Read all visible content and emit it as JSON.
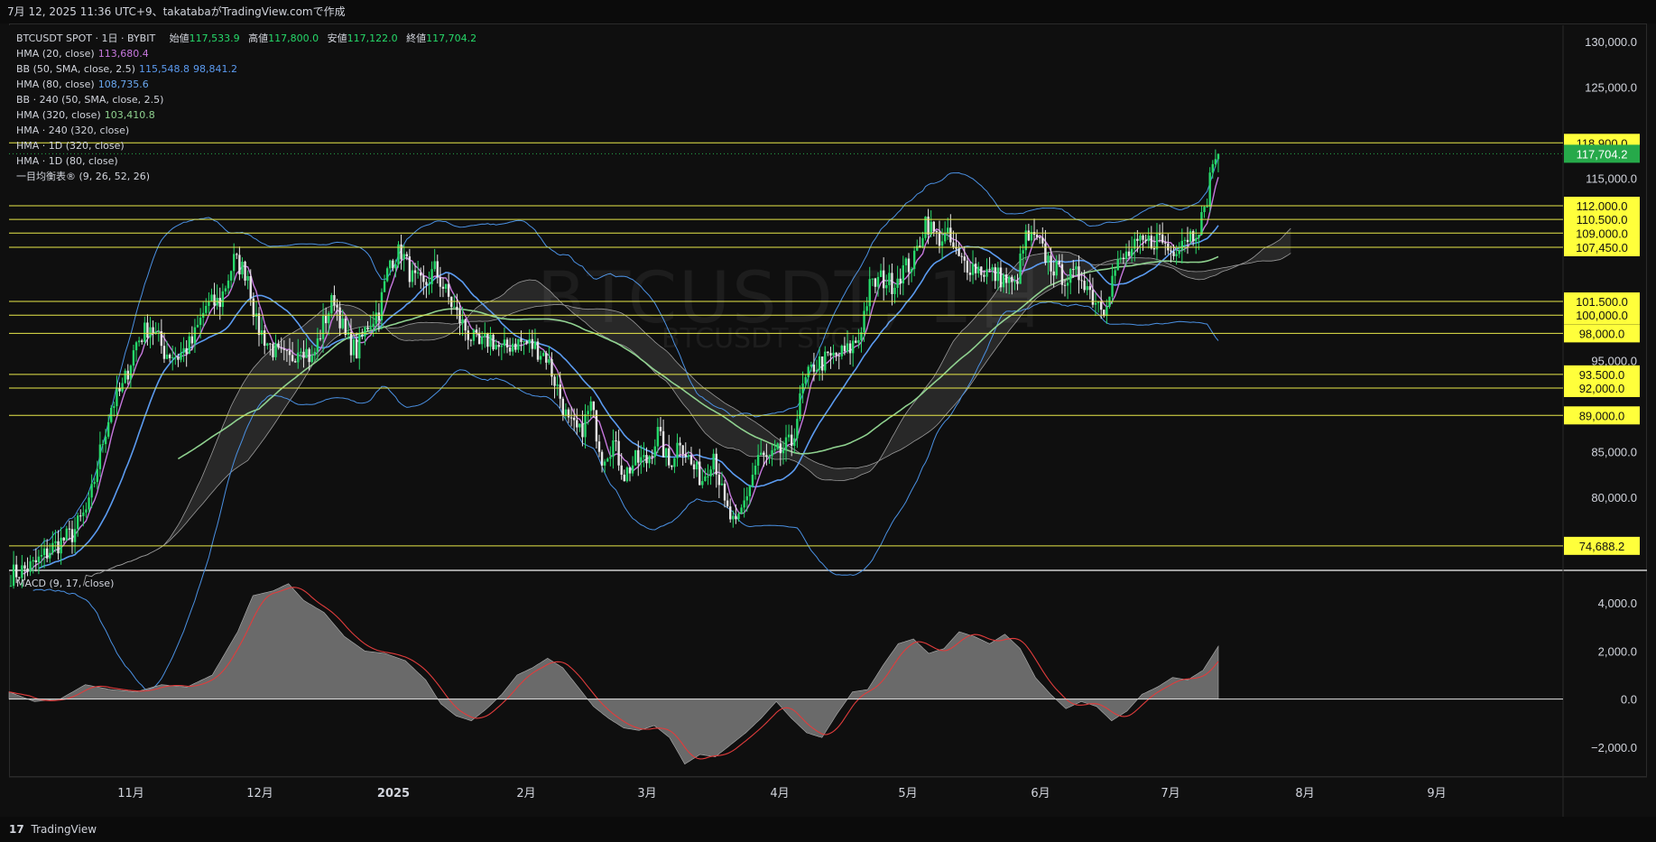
{
  "header": {
    "text": "7月 12, 2025 11:36 UTC+9、takatabaがTradingView.comで作成"
  },
  "legend": {
    "symbol": "BTCUSDT SPOT · 1日 · BYBIT",
    "ohlc": [
      {
        "k": "始値",
        "v": "117,533.9"
      },
      {
        "k": "高値",
        "v": "117,800.0"
      },
      {
        "k": "安値",
        "v": "117,122.0"
      },
      {
        "k": "終値",
        "v": "117,704.2"
      }
    ],
    "indicators": [
      {
        "name": "HMA (20, close)",
        "value": "113,680.4",
        "color": "#c678dd"
      },
      {
        "name": "BB (50, SMA, close, 2.5)",
        "value": "115,548.8",
        "value2": "98,841.2",
        "color": "#5b9bf0"
      },
      {
        "name": "HMA (80, close)",
        "value": "108,735.6",
        "color": "#4a90e2"
      },
      {
        "name": "BB · 240 (50, SMA, close, 2.5)",
        "value": "",
        "color": "#d1d4dc"
      },
      {
        "name": "HMA (320, close)",
        "value": "103,410.8",
        "color": "#8fd18f"
      },
      {
        "name": "HMA · 240 (320, close)",
        "value": "",
        "color": "#d1d4dc"
      },
      {
        "name": "HMA · 1D (320, close)",
        "value": "",
        "color": "#d1d4dc"
      },
      {
        "name": "HMA · 1D (80, close)",
        "value": "",
        "color": "#d1d4dc"
      },
      {
        "name": "一目均衡表® (9, 26, 52, 26)",
        "value": "",
        "color": "#d1d4dc"
      }
    ]
  },
  "watermark": {
    "line1": "BTCUSDT, 1日",
    "line2": "BTCUSDT SPOT"
  },
  "macd": {
    "label": "MACD (9, 17, close)"
  },
  "footer": {
    "logo": "17",
    "text": "TradingView"
  },
  "colors": {
    "up": "#26d96a",
    "down": "#e6e6e6",
    "level": "#e8e84a",
    "hma20": "#c678dd",
    "bb": "#4a90e2",
    "hma320": "#8fd18f",
    "macd_line": "#e03c3c",
    "last_price": "#26a94a"
  },
  "chart_data": {
    "type": "candlestick",
    "price_axis": {
      "ticks": [
        130000,
        125000,
        115000,
        95000,
        85000,
        80000
      ],
      "range": [
        72000,
        131800
      ]
    },
    "levels": [
      118900,
      112000,
      110500,
      109000,
      107450,
      101500,
      100000,
      98000,
      93500,
      92000,
      89000,
      74688.2
    ],
    "level_labels": [
      "118,900.0",
      "112,000.0",
      "110,500.0",
      "109,000.0",
      "107,450.0",
      "101,500.0",
      "100,000.0",
      "98,000.0",
      "93,500.0",
      "92,000.0",
      "89,000.0",
      "74,688.2"
    ],
    "last_price": 117704.2,
    "last_price_label": "117,704.2",
    "time_axis": [
      "11月",
      "12月",
      "2025",
      "2月",
      "3月",
      "4月",
      "5月",
      "6月",
      "7月",
      "8月",
      "9月"
    ],
    "close_path": [
      [
        0,
        71500
      ],
      [
        8,
        72500
      ],
      [
        15,
        74500
      ],
      [
        22,
        76000
      ],
      [
        28,
        79000
      ],
      [
        32,
        85000
      ],
      [
        36,
        90000
      ],
      [
        40,
        92000
      ],
      [
        45,
        97000
      ],
      [
        50,
        99000
      ],
      [
        55,
        96000
      ],
      [
        60,
        95500
      ],
      [
        65,
        97000
      ],
      [
        70,
        101000
      ],
      [
        75,
        101500
      ],
      [
        80,
        106000
      ],
      [
        85,
        104500
      ],
      [
        88,
        99000
      ],
      [
        92,
        97000
      ],
      [
        96,
        95500
      ],
      [
        100,
        95000
      ],
      [
        104,
        97000
      ],
      [
        108,
        95000
      ],
      [
        112,
        99000
      ],
      [
        116,
        102000
      ],
      [
        120,
        97500
      ],
      [
        124,
        96000
      ],
      [
        128,
        99000
      ],
      [
        132,
        100500
      ],
      [
        136,
        106000
      ],
      [
        140,
        107000
      ],
      [
        144,
        104000
      ],
      [
        148,
        103000
      ],
      [
        152,
        105000
      ],
      [
        156,
        102500
      ],
      [
        160,
        100000
      ],
      [
        164,
        98000
      ],
      [
        168,
        96500
      ],
      [
        172,
        97500
      ],
      [
        176,
        96000
      ],
      [
        180,
        97000
      ],
      [
        184,
        97000
      ],
      [
        188,
        96500
      ],
      [
        192,
        95500
      ],
      [
        196,
        92000
      ],
      [
        200,
        88000
      ],
      [
        204,
        87000
      ],
      [
        208,
        90000
      ],
      [
        212,
        84500
      ],
      [
        216,
        86000
      ],
      [
        220,
        82500
      ],
      [
        224,
        84000
      ],
      [
        228,
        84000
      ],
      [
        232,
        87000
      ],
      [
        236,
        83500
      ],
      [
        240,
        86500
      ],
      [
        244,
        83500
      ],
      [
        248,
        82000
      ],
      [
        252,
        85000
      ],
      [
        256,
        79000
      ],
      [
        260,
        76500
      ],
      [
        264,
        80500
      ],
      [
        268,
        84500
      ],
      [
        272,
        84000
      ],
      [
        276,
        85000
      ],
      [
        280,
        86000
      ],
      [
        284,
        92000
      ],
      [
        288,
        94500
      ],
      [
        292,
        95000
      ],
      [
        296,
        95500
      ],
      [
        300,
        96000
      ],
      [
        304,
        97500
      ],
      [
        308,
        103000
      ],
      [
        312,
        104000
      ],
      [
        316,
        103500
      ],
      [
        320,
        105000
      ],
      [
        324,
        106000
      ],
      [
        328,
        110500
      ],
      [
        332,
        108500
      ],
      [
        336,
        108500
      ],
      [
        340,
        106000
      ],
      [
        344,
        105500
      ],
      [
        348,
        105000
      ],
      [
        352,
        104500
      ],
      [
        356,
        104000
      ],
      [
        360,
        103000
      ],
      [
        364,
        108500
      ],
      [
        368,
        108000
      ],
      [
        372,
        106000
      ],
      [
        376,
        104500
      ],
      [
        380,
        104000
      ],
      [
        384,
        104500
      ],
      [
        388,
        102000
      ],
      [
        392,
        101000
      ],
      [
        396,
        105000
      ],
      [
        400,
        106500
      ],
      [
        404,
        107500
      ],
      [
        408,
        108000
      ],
      [
        412,
        108500
      ],
      [
        416,
        107000
      ],
      [
        420,
        108500
      ],
      [
        424,
        109000
      ],
      [
        428,
        111000
      ],
      [
        431,
        117000
      ],
      [
        433,
        117704
      ]
    ],
    "candles_total": 434,
    "macd_axis": {
      "ticks": [
        4000,
        2000,
        0,
        -2000
      ],
      "range": [
        -3200,
        5200
      ]
    },
    "macd_hist": [
      [
        0,
        300
      ],
      [
        10,
        -100
      ],
      [
        20,
        0
      ],
      [
        30,
        600
      ],
      [
        40,
        400
      ],
      [
        50,
        300
      ],
      [
        60,
        600
      ],
      [
        70,
        500
      ],
      [
        80,
        1000
      ],
      [
        90,
        2800
      ],
      [
        96,
        4300
      ],
      [
        104,
        4500
      ],
      [
        110,
        4800
      ],
      [
        116,
        4100
      ],
      [
        124,
        3600
      ],
      [
        132,
        2600
      ],
      [
        140,
        2000
      ],
      [
        148,
        1900
      ],
      [
        156,
        1600
      ],
      [
        164,
        800
      ],
      [
        170,
        -200
      ],
      [
        176,
        -700
      ],
      [
        182,
        -900
      ],
      [
        188,
        -400
      ],
      [
        194,
        200
      ],
      [
        200,
        1000
      ],
      [
        206,
        1300
      ],
      [
        212,
        1700
      ],
      [
        218,
        1300
      ],
      [
        224,
        500
      ],
      [
        230,
        -300
      ],
      [
        236,
        -800
      ],
      [
        242,
        -1200
      ],
      [
        248,
        -1300
      ],
      [
        254,
        -1100
      ],
      [
        260,
        -1600
      ],
      [
        266,
        -2700
      ],
      [
        272,
        -2300
      ],
      [
        278,
        -2400
      ],
      [
        284,
        -1900
      ],
      [
        290,
        -1400
      ],
      [
        296,
        -800
      ],
      [
        302,
        -100
      ],
      [
        308,
        -800
      ],
      [
        314,
        -1400
      ],
      [
        320,
        -1600
      ],
      [
        326,
        -600
      ],
      [
        332,
        300
      ],
      [
        338,
        400
      ],
      [
        344,
        1400
      ],
      [
        350,
        2300
      ],
      [
        356,
        2500
      ],
      [
        362,
        1900
      ],
      [
        368,
        2100
      ],
      [
        374,
        2800
      ],
      [
        380,
        2600
      ],
      [
        386,
        2300
      ],
      [
        392,
        2700
      ],
      [
        398,
        2100
      ],
      [
        404,
        900
      ],
      [
        410,
        200
      ],
      [
        416,
        -400
      ],
      [
        422,
        -100
      ],
      [
        428,
        -300
      ],
      [
        434,
        -900
      ],
      [
        440,
        -500
      ],
      [
        446,
        200
      ],
      [
        452,
        500
      ],
      [
        458,
        900
      ],
      [
        464,
        800
      ],
      [
        470,
        1200
      ],
      [
        476,
        2200
      ]
    ]
  }
}
